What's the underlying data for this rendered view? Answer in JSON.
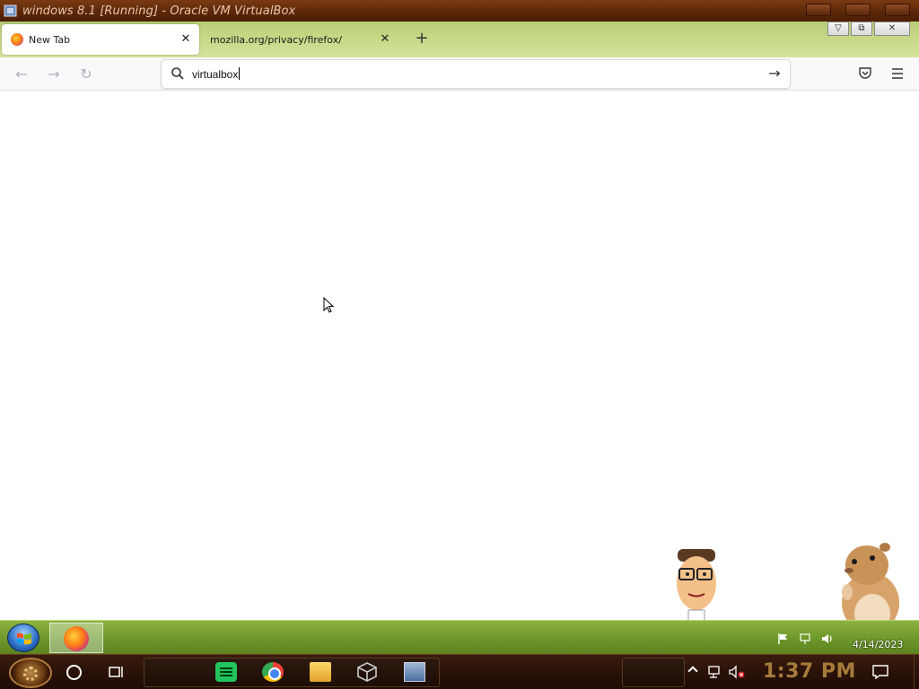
{
  "vbox": {
    "title": "windows 8.1 [Running] - Oracle VM VirtualBox"
  },
  "browser": {
    "tabs": [
      {
        "label": "New Tab",
        "active": true
      },
      {
        "label": "mozilla.org/privacy/firefox/",
        "active": false
      }
    ],
    "close_glyph": "✕",
    "newtab_glyph": "+",
    "urlbar": {
      "value": "virtualbox",
      "go_glyph": "→"
    },
    "nav": {
      "back_glyph": "←",
      "forward_glyph": "→",
      "reload_glyph": "↻"
    },
    "guest_window_controls": {
      "minimize": "▽",
      "restore": "⧉",
      "close": "✕"
    }
  },
  "guest_taskbar": {
    "date": "4/14/2023"
  },
  "host_taskbar": {
    "clock": "1:37 PM"
  },
  "colors": {
    "tabstrip": "#c4d784",
    "guest_taskbar": "#6f9a2c",
    "host_taskbar": "#2a1208",
    "clock": "#a77b3b"
  },
  "icons": [
    "virtualbox-icon",
    "firefox-icon",
    "search-icon",
    "arrow-right-icon",
    "pocket-icon",
    "hamburger-menu-icon",
    "windows-start-icon",
    "cortana-icon",
    "task-view-icon",
    "spotify-icon",
    "chrome-icon",
    "file-explorer-icon",
    "virtualbox-app-icon",
    "network-icon",
    "volume-muted-icon",
    "flag-icon",
    "notification-icon"
  ]
}
